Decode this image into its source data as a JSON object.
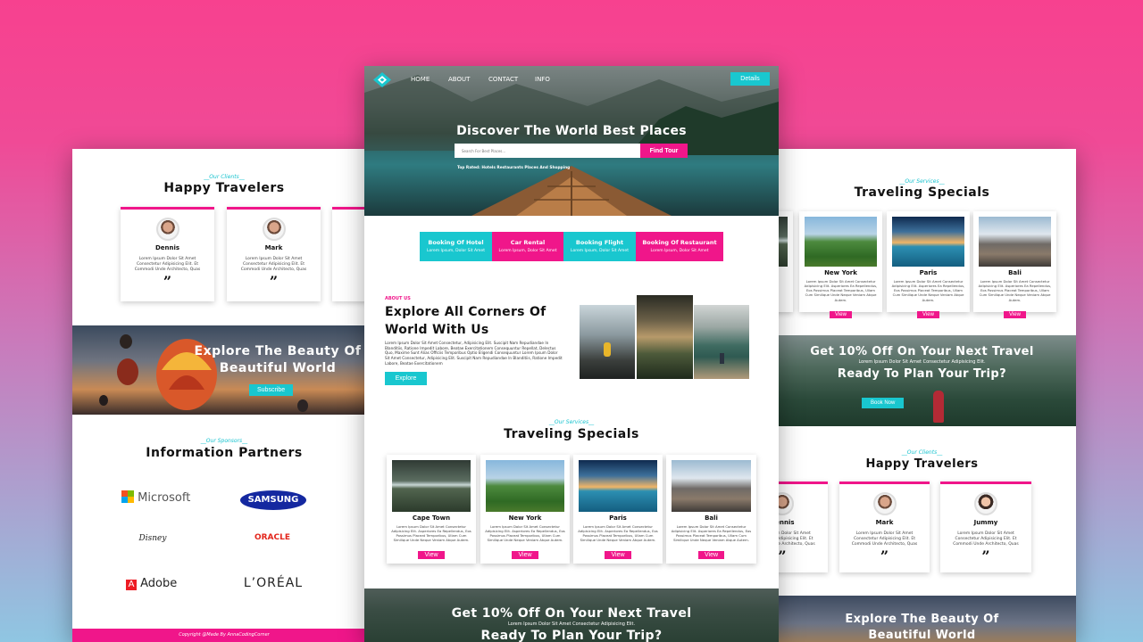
{
  "colors": {
    "accent_teal": "#19c7cf",
    "accent_pink": "#f0168a",
    "background_top": "#f7418f",
    "background_bottom": "#8fc6e2"
  },
  "center": {
    "nav": {
      "logo_icon": "diamond-logo-icon",
      "links": [
        "HOME",
        "ABOUT",
        "CONTACT",
        "INFO"
      ],
      "details_button": "Details"
    },
    "hero": {
      "title": "Discover The World Best Places",
      "search_placeholder": "Search For Best Places...",
      "search_button": "Find Tour",
      "top_rated": "Top Rated: Hotels Restaurants Places And Shopping"
    },
    "booking_tabs": [
      {
        "title": "Booking Of Hotel",
        "text": "Lorem Ipsum, Dolor Sit Amet",
        "color": "#19c7cf"
      },
      {
        "title": "Car Rental",
        "text": "Lorem Ipsum, Dolor Sit Amet",
        "color": "#f0168a"
      },
      {
        "title": "Booking Flight",
        "text": "Lorem Ipsum, Dolor Sit Amet",
        "color": "#19c7cf"
      },
      {
        "title": "Booking Of Restaurant",
        "text": "Lorem Ipsum, Dolor Sit Amet",
        "color": "#f0168a"
      }
    ],
    "about": {
      "label": "ABOUT US",
      "title_line1": "Explore All Corners Of",
      "title_line2": "World With Us",
      "text": "Lorem Ipsum Dolor Sit Amet Consectetur, Adipisicing Elit. Suscipit Nam Repudiandae In Blanditiis, Ratione Impedit Labore, Beatae Exercitationem Consequuntur Repellat, Delectus Quo, Maxime Sunt Alias Officiis Temporibus Optio Eligendi Consequuntur Lorem Ipsum Dolor Sit Amet Consectetur, Adipisicing Elit. Suscipit Nam Repudiandae In Blanditiis, Ratione Impedit Labore, Beatae Exercitationem",
      "button": "Explore"
    },
    "specials": {
      "label": "__Our Services__",
      "title": "Traveling Specials",
      "items": [
        {
          "name": "Cape Town",
          "text": "Lorem Ipsum Dolor Sit Amet Consectetur Adipisicing Elit. Asperiores Ea Repellendus, Eos Possimus Placeat Temporibus, Ullam Cum Similique Unde Neque Veniam Atque Autem.",
          "button": "View"
        },
        {
          "name": "New York",
          "text": "Lorem Ipsum Dolor Sit Amet Consectetur Adipisicing Elit. Asperiores Ea Repellendus, Eos Possimus Placeat Temporibus, Ullam Cum Similique Unde Neque Veniam Atque Autem.",
          "button": "View"
        },
        {
          "name": "Paris",
          "text": "Lorem Ipsum Dolor Sit Amet Consectetur Adipisicing Elit. Asperiores Ea Repellendus, Eos Possimus Placeat Temporibus, Ullam Cum Similique Unde Neque Veniam Atque Autem.",
          "button": "View"
        },
        {
          "name": "Bali",
          "text": "Lorem Ipsum Dolor Sit Amet Consectetur Adipisicing Elit. Asperiores Ea Repellendus, Eos Possimus Placeat Temporibus, Ullam Cum Similique Unde Neque Veniam Atque Autem.",
          "button": "View"
        }
      ]
    },
    "offer": {
      "title": "Get 10% Off On Your Next Travel",
      "text": "Lorem Ipsum Dolor Sit Amet Consectetur Adipisicing Elit.",
      "title2": "Ready To Plan Your Trip?"
    }
  },
  "left": {
    "clients": {
      "label": "__Our Clients__",
      "title": "Happy Travelers",
      "items": [
        {
          "name": "Dennis",
          "text": "Lorem Ipsum Dolor Sit Amet Consectetur Adipisicing Elit. Et Commodi Unde Architecto, Quas",
          "quote": "”"
        },
        {
          "name": "Mark",
          "text": "Lorem Ipsum Dolor Sit Amet Consectetur Adipisicing Elit. Et Commodi Unde Architecto, Quas",
          "quote": "”"
        }
      ]
    },
    "explore": {
      "title_line1": "Explore The Beauty Of",
      "title_line2": "Beautiful World",
      "button": "Subscribe"
    },
    "partners": {
      "label": "__Our Sponsors__",
      "title": "Information Partners",
      "logos": [
        "Microsoft",
        "SAMSUNG",
        "Disney",
        "ORACLE",
        "Adobe",
        "L’ORÉAL"
      ]
    },
    "footer": "Copyright @Made By AnnaCodingCorner"
  },
  "right": {
    "specials": {
      "label": "__Our Services__",
      "title": "Traveling Specials",
      "items": [
        {
          "name": "New York",
          "text": "Lorem Ipsum Dolor Sit Amet Consectetur Adipisicing Elit. Asperiores Ea Repellendus, Eos Possimus Placeat Temporibus, Ullam Cum Similique Unde Neque Veniam Atque Autem.",
          "button": "View"
        },
        {
          "name": "Paris",
          "text": "Lorem Ipsum Dolor Sit Amet Consectetur Adipisicing Elit. Asperiores Ea Repellendus, Eos Possimus Placeat Temporibus, Ullam Cum Similique Unde Neque Veniam Atque Autem.",
          "button": "View"
        },
        {
          "name": "Bali",
          "text": "Lorem Ipsum Dolor Sit Amet Consectetur Adipisicing Elit. Asperiores Ea Repellendus, Eos Possimus Placeat Temporibus, Ullam Cum Similique Unde Neque Veniam Atque Autem.",
          "button": "View"
        }
      ]
    },
    "offer": {
      "title": "Get 10% Off On Your Next Travel",
      "text": "Lorem Ipsum Dolor Sit Amet Consectetur Adipisicing Elit.",
      "title2": "Ready To Plan Your Trip?",
      "button": "Book Now"
    },
    "clients": {
      "label": "__Our Clients__",
      "title": "Happy Travelers",
      "items": [
        {
          "name": "Dennis",
          "text": "Lorem Ipsum Dolor Sit Amet Consectetur Adipisicing Elit. Et Commodi Unde Architecto, Quas",
          "quote": "”"
        },
        {
          "name": "Mark",
          "text": "Lorem Ipsum Dolor Sit Amet Consectetur Adipisicing Elit. Et Commodi Unde Architecto, Quas",
          "quote": "”"
        },
        {
          "name": "Jummy",
          "text": "Lorem Ipsum Dolor Sit Amet Consectetur Adipisicing Elit. Et Commodi Unde Architecto, Quas",
          "quote": "”"
        }
      ]
    },
    "explore": {
      "title_line1": "Explore The Beauty Of",
      "title_line2": "Beautiful World"
    }
  }
}
